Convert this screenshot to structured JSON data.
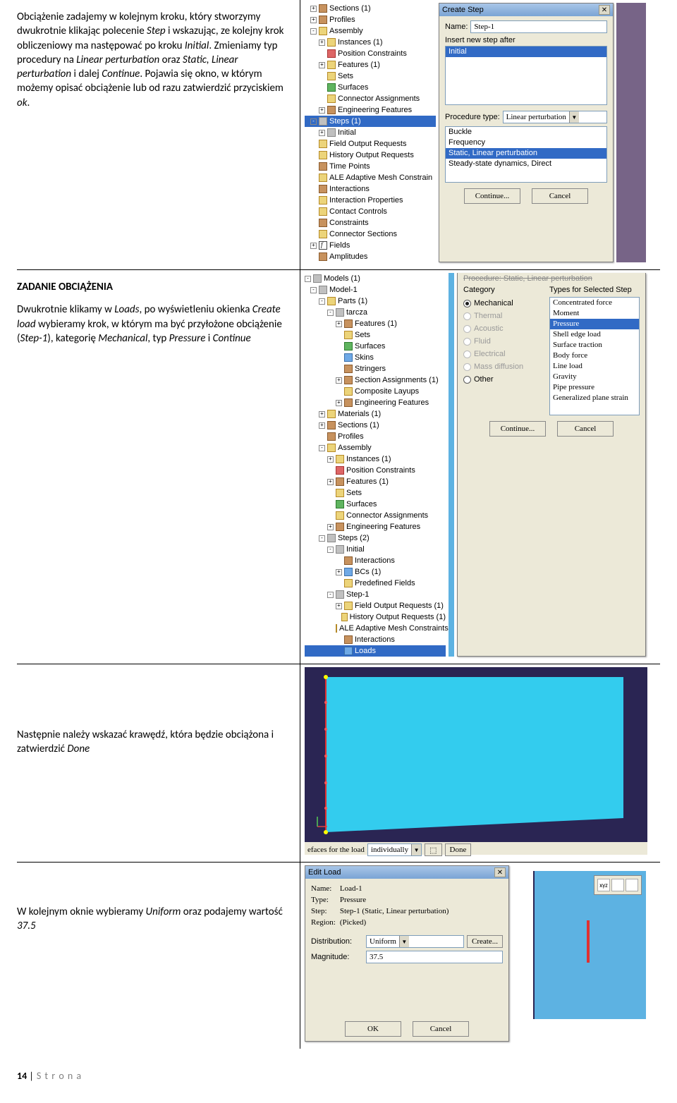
{
  "body": {
    "p1_a": "Obciążenie zadajemy w kolejnym kroku, który stworzymy dwukrotnie klikając polecenie ",
    "p1_b": " i wskazując, ze kolejny krok obliczeniowy ma następować po kroku ",
    "p1_c": ". Zmieniamy typ procedury na ",
    "p1_d": " oraz ",
    "p1_e": " i dalej ",
    "p1_f": ". Pojawia się okno, w którym możemy opisać obciążenie lub od razu zatwierdzić przyciskiem ",
    "p1_g": ".",
    "step": "Step",
    "initial": "Initial",
    "linperturb": "Linear perturbation",
    "slp": "Static, Linear perturbation",
    "continue": "Continue",
    "ok": "ok",
    "h1": "ZADANIE OBCIĄŻENIA",
    "p2_a": "Dwukrotnie klikamy w ",
    "p2_b": ", po wyświetleniu okienka ",
    "p2_c": " wybieramy krok, w którym ma być przyłożone obciążenie (",
    "p2_d": "), kategorię ",
    "p2_e": ", typ ",
    "p2_f": " i ",
    "loads": "Loads",
    "createload": "Create load",
    "step1": "Step-1",
    "mechanical": "Mechanical",
    "pressure": "Pressure",
    "p3_a": "Następnie należy wskazać krawędź, która będzie obciążona i zatwierdzić ",
    "done": "Done",
    "p4_a": "W kolejnym oknie wybieramy ",
    "p4_b": " oraz podajemy wartość ",
    "uniform": "Uniform",
    "val": "37.5"
  },
  "fig1": {
    "tree": [
      {
        "l": 1,
        "e": "+",
        "i": "ico-brown",
        "t": "Sections (1)"
      },
      {
        "l": 1,
        "e": "+",
        "i": "ico-brown",
        "t": "Profiles"
      },
      {
        "l": 1,
        "e": "-",
        "i": "ico-yellow",
        "t": "Assembly"
      },
      {
        "l": 2,
        "e": "+",
        "i": "ico-yellow",
        "t": "Instances (1)"
      },
      {
        "l": 2,
        "e": "",
        "i": "ico-red",
        "t": "Position Constraints"
      },
      {
        "l": 2,
        "e": "+",
        "i": "ico-yellow",
        "t": "Features (1)"
      },
      {
        "l": 2,
        "e": "",
        "i": "ico-yellow",
        "t": "Sets"
      },
      {
        "l": 2,
        "e": "",
        "i": "ico-green",
        "t": "Surfaces"
      },
      {
        "l": 2,
        "e": "",
        "i": "ico-yellow",
        "t": "Connector Assignments"
      },
      {
        "l": 2,
        "e": "+",
        "i": "ico-brown",
        "t": "Engineering Features"
      },
      {
        "l": 1,
        "e": "-",
        "i": "ico-grey",
        "t": "Steps (1)",
        "sel": true
      },
      {
        "l": 2,
        "e": "+",
        "i": "ico-grey",
        "t": "Initial"
      },
      {
        "l": 1,
        "e": "",
        "i": "ico-yellow",
        "t": "Field Output Requests"
      },
      {
        "l": 1,
        "e": "",
        "i": "ico-yellow",
        "t": "History Output Requests"
      },
      {
        "l": 1,
        "e": "",
        "i": "ico-brown",
        "t": "Time Points"
      },
      {
        "l": 1,
        "e": "",
        "i": "ico-yellow",
        "t": "ALE Adaptive Mesh Constrain"
      },
      {
        "l": 1,
        "e": "",
        "i": "ico-brown",
        "t": "Interactions"
      },
      {
        "l": 1,
        "e": "",
        "i": "ico-yellow",
        "t": "Interaction Properties"
      },
      {
        "l": 1,
        "e": "",
        "i": "ico-yellow",
        "t": "Contact Controls"
      },
      {
        "l": 1,
        "e": "",
        "i": "ico-brown",
        "t": "Constraints"
      },
      {
        "l": 1,
        "e": "",
        "i": "ico-yellow",
        "t": "Connector Sections"
      },
      {
        "l": 1,
        "e": "+",
        "i": "ico-f",
        "t": "Fields"
      },
      {
        "l": 1,
        "e": "",
        "i": "ico-brown",
        "t": "Amplitudes"
      }
    ],
    "dlg": {
      "title": "Create Step",
      "nameLabel": "Name:",
      "nameValue": "Step-1",
      "insertLabel": "Insert new step after",
      "listSel": "Initial",
      "procLabel": "Procedure type:",
      "procValue": "Linear perturbation",
      "options": [
        "Buckle",
        "Frequency",
        "Static, Linear perturbation",
        "Steady-state dynamics, Direct"
      ],
      "selIdx": 2,
      "continueBtn": "Continue...",
      "cancelBtn": "Cancel"
    }
  },
  "fig2": {
    "tree": [
      {
        "l": 0,
        "e": "-",
        "i": "ico-grey",
        "t": "Models (1)"
      },
      {
        "l": 1,
        "e": "-",
        "i": "ico-grey",
        "t": "Model-1"
      },
      {
        "l": 2,
        "e": "-",
        "i": "ico-yellow",
        "t": "Parts (1)"
      },
      {
        "l": 3,
        "e": "-",
        "i": "ico-grey",
        "t": "tarcza"
      },
      {
        "l": 4,
        "e": "+",
        "i": "ico-brown",
        "t": "Features (1)"
      },
      {
        "l": 4,
        "e": "",
        "i": "ico-yellow",
        "t": "Sets"
      },
      {
        "l": 4,
        "e": "",
        "i": "ico-green",
        "t": "Surfaces"
      },
      {
        "l": 4,
        "e": "",
        "i": "ico-blue",
        "t": "Skins"
      },
      {
        "l": 4,
        "e": "",
        "i": "ico-brown",
        "t": "Stringers"
      },
      {
        "l": 4,
        "e": "+",
        "i": "ico-brown",
        "t": "Section Assignments (1)"
      },
      {
        "l": 4,
        "e": "",
        "i": "ico-yellow",
        "t": "Composite Layups"
      },
      {
        "l": 4,
        "e": "+",
        "i": "ico-brown",
        "t": "Engineering Features"
      },
      {
        "l": 2,
        "e": "+",
        "i": "ico-yellow",
        "t": "Materials (1)"
      },
      {
        "l": 2,
        "e": "+",
        "i": "ico-brown",
        "t": "Sections (1)"
      },
      {
        "l": 2,
        "e": "",
        "i": "ico-brown",
        "t": "Profiles"
      },
      {
        "l": 2,
        "e": "-",
        "i": "ico-yellow",
        "t": "Assembly"
      },
      {
        "l": 3,
        "e": "+",
        "i": "ico-yellow",
        "t": "Instances (1)"
      },
      {
        "l": 3,
        "e": "",
        "i": "ico-red",
        "t": "Position Constraints"
      },
      {
        "l": 3,
        "e": "+",
        "i": "ico-brown",
        "t": "Features (1)"
      },
      {
        "l": 3,
        "e": "",
        "i": "ico-yellow",
        "t": "Sets"
      },
      {
        "l": 3,
        "e": "",
        "i": "ico-green",
        "t": "Surfaces"
      },
      {
        "l": 3,
        "e": "",
        "i": "ico-yellow",
        "t": "Connector Assignments"
      },
      {
        "l": 3,
        "e": "+",
        "i": "ico-brown",
        "t": "Engineering Features"
      },
      {
        "l": 2,
        "e": "-",
        "i": "ico-grey",
        "t": "Steps (2)"
      },
      {
        "l": 3,
        "e": "-",
        "i": "ico-grey",
        "t": "Initial"
      },
      {
        "l": 4,
        "e": "",
        "i": "ico-brown",
        "t": "Interactions"
      },
      {
        "l": 4,
        "e": "+",
        "i": "ico-blue",
        "t": "BCs (1)"
      },
      {
        "l": 4,
        "e": "",
        "i": "ico-yellow",
        "t": "Predefined Fields"
      },
      {
        "l": 3,
        "e": "-",
        "i": "ico-grey",
        "t": "Step-1"
      },
      {
        "l": 4,
        "e": "+",
        "i": "ico-yellow",
        "t": "Field Output Requests (1)"
      },
      {
        "l": 4,
        "e": "",
        "i": "ico-yellow",
        "t": "History Output Requests (1)"
      },
      {
        "l": 4,
        "e": "",
        "i": "ico-yellow",
        "t": "ALE Adaptive Mesh Constraints"
      },
      {
        "l": 4,
        "e": "",
        "i": "ico-brown",
        "t": "Interactions"
      },
      {
        "l": 4,
        "e": "",
        "i": "ico-blue",
        "t": "Loads",
        "sel": true
      }
    ],
    "dlg": {
      "topText": "Procedure: Static, Linear perturbation",
      "catLabel": "Category",
      "cats": [
        "Mechanical",
        "Thermal",
        "Acoustic",
        "Fluid",
        "Electrical",
        "Mass diffusion",
        "Other"
      ],
      "typesLabel": "Types for Selected Step",
      "types": [
        "Concentrated force",
        "Moment",
        "Pressure",
        "Shell edge load",
        "Surface traction",
        "Body force",
        "Line load",
        "Gravity",
        "Pipe pressure",
        "Generalized plane strain"
      ],
      "selType": 2,
      "continueBtn": "Continue...",
      "cancelBtn": "Cancel"
    }
  },
  "fig3": {
    "prompt": "efaces for the load",
    "dd": "individually",
    "done": "Done"
  },
  "fig4": {
    "title": "Edit Load",
    "nameLabel": "Name:",
    "nameVal": "Load-1",
    "typeLabel": "Type:",
    "typeVal": "Pressure",
    "stepLabel": "Step:",
    "stepVal": "Step-1 (Static, Linear perturbation)",
    "regionLabel": "Region:",
    "regionVal": "(Picked)",
    "distLabel": "Distribution:",
    "distVal": "Uniform",
    "createBtn": "Create...",
    "magLabel": "Magnitude:",
    "magVal": "37.5",
    "okBtn": "OK",
    "cancelBtn": "Cancel"
  },
  "footer": {
    "page": "14",
    "strona": "S t r o n a"
  }
}
